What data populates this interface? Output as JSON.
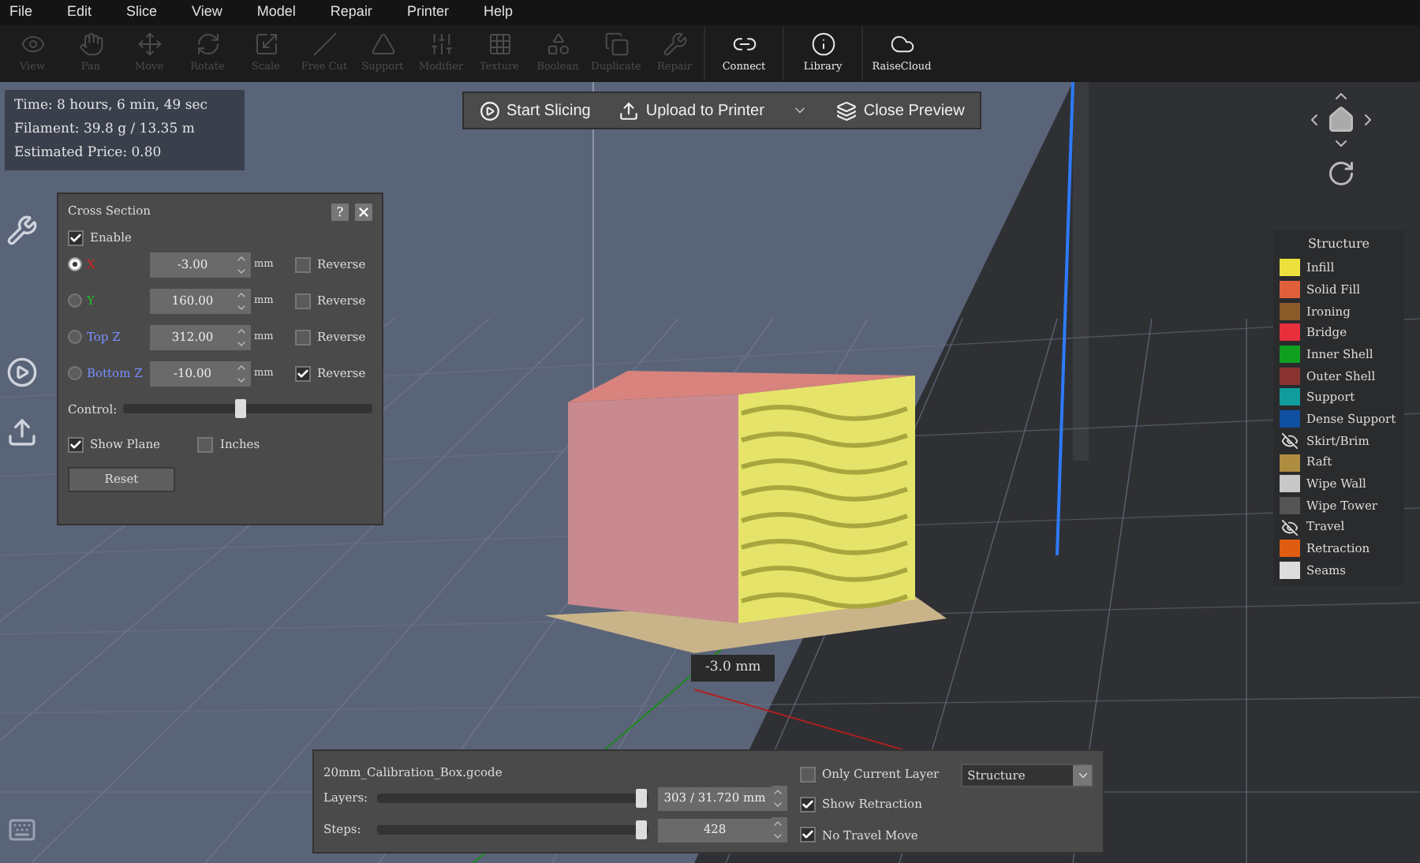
{
  "menu": [
    "File",
    "Edit",
    "Slice",
    "View",
    "Model",
    "Repair",
    "Printer",
    "Help"
  ],
  "toolbar": [
    {
      "kind": "view",
      "label": "View",
      "disabled": true
    },
    {
      "kind": "pan",
      "label": "Pan",
      "disabled": true
    },
    {
      "kind": "move",
      "label": "Move",
      "disabled": true
    },
    {
      "kind": "rotate",
      "label": "Rotate",
      "disabled": true
    },
    {
      "kind": "scale",
      "label": "Scale",
      "disabled": true
    },
    {
      "kind": "cut",
      "label": "Free Cut",
      "disabled": true
    },
    {
      "kind": "support",
      "label": "Support",
      "disabled": true
    },
    {
      "kind": "modifier",
      "label": "Modifier",
      "disabled": true
    },
    {
      "kind": "texture",
      "label": "Texture",
      "disabled": true
    },
    {
      "kind": "boolean",
      "label": "Boolean",
      "disabled": true
    },
    {
      "kind": "duplicate",
      "label": "Duplicate",
      "disabled": true
    },
    {
      "kind": "repair",
      "label": "Repair",
      "disabled": true
    },
    {
      "kind": "connect",
      "label": "Connect",
      "disabled": false
    },
    {
      "kind": "library",
      "label": "Library",
      "disabled": false
    },
    {
      "kind": "cloud",
      "label": "RaiseCloud",
      "disabled": false
    }
  ],
  "stats": [
    "Time: 8 hours, 6 min, 49 sec",
    "Filament: 39.8 g / 13.35 m",
    "Estimated Price: 0.80"
  ],
  "actions": [
    {
      "kind": "play",
      "label": "Start Slicing"
    },
    {
      "kind": "upload",
      "label": "Upload to Printer",
      "dropdown": true
    },
    {
      "kind": "layers",
      "label": "Close Preview"
    }
  ],
  "cross_section": {
    "title": "Cross Section",
    "help": "?",
    "enable": {
      "label": "Enable",
      "checked": true
    },
    "rows": [
      {
        "axis": "X",
        "color": "#e02020",
        "selected": true,
        "value": "-3.00",
        "unit": "mm",
        "reverse": {
          "label": "Reverse",
          "checked": false
        }
      },
      {
        "axis": "Y",
        "color": "#20c020",
        "selected": false,
        "value": "160.00",
        "unit": "mm",
        "reverse": {
          "label": "Reverse",
          "checked": false
        }
      },
      {
        "axis": "Top Z",
        "color": "#7a90ff",
        "selected": false,
        "value": "312.00",
        "unit": "mm",
        "reverse": {
          "label": "Reverse",
          "checked": false
        }
      },
      {
        "axis": "Bottom Z",
        "color": "#7a90ff",
        "selected": false,
        "value": "-10.00",
        "unit": "mm",
        "reverse": {
          "label": "Reverse",
          "checked": true
        }
      }
    ],
    "control": {
      "label": "Control:",
      "level": 0.47
    },
    "show_plane": {
      "label": "Show Plane",
      "checked": true
    },
    "inches": {
      "label": "Inches",
      "checked": false
    },
    "reset": "Reset"
  },
  "legend": {
    "title": "Structure",
    "items": [
      {
        "kind": "swatch",
        "label": "Infill",
        "color": "#ece03c"
      },
      {
        "kind": "swatch",
        "label": "Solid Fill",
        "color": "#e0603c"
      },
      {
        "kind": "swatch",
        "label": "Ironing",
        "color": "#8a5a28"
      },
      {
        "kind": "swatch",
        "label": "Bridge",
        "color": "#e8303c"
      },
      {
        "kind": "swatch",
        "label": "Inner Shell",
        "color": "#10a020"
      },
      {
        "kind": "swatch",
        "label": "Outer Shell",
        "color": "#8a3432"
      },
      {
        "kind": "swatch",
        "label": "Support",
        "color": "#109c9c"
      },
      {
        "kind": "swatch",
        "label": "Dense Support",
        "color": "#1050a0"
      },
      {
        "kind": "hidden",
        "label": "Skirt/Brim"
      },
      {
        "kind": "swatch",
        "label": "Raft",
        "color": "#ae8c40"
      },
      {
        "kind": "swatch",
        "label": "Wipe Wall",
        "color": "#c8c8c8"
      },
      {
        "kind": "swatch",
        "label": "Wipe Tower",
        "color": "#555555"
      },
      {
        "kind": "hidden",
        "label": "Travel"
      },
      {
        "kind": "swatch",
        "label": "Retraction",
        "color": "#e05c10"
      },
      {
        "kind": "swatch",
        "label": "Seams",
        "color": "#dcdcdc"
      }
    ]
  },
  "cut_label": "-3.0 mm",
  "preview": {
    "file": "20mm_Calibration_Box.gcode",
    "layers": {
      "label": "Layers:",
      "level": 0.97,
      "value": "303 / 31.720 mm"
    },
    "steps": {
      "label": "Steps:",
      "level": 0.97,
      "value": "428"
    },
    "only_current_layer": {
      "label": "Only Current Layer",
      "checked": false
    },
    "show_retraction": {
      "label": "Show Retraction",
      "checked": true
    },
    "no_travel_move": {
      "label": "No Travel Move",
      "checked": true
    },
    "view_mode": "Structure"
  }
}
